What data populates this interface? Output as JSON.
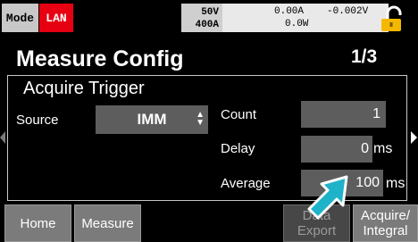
{
  "status": {
    "mode_label": "Mode",
    "interface_label": "LAN",
    "voltage_range": "50V",
    "current_range": "400A",
    "current_reading": "0.00A",
    "power_reading": "0.0W",
    "voltage_reading": "-0.002V",
    "lock_icon": "padlock-unlocked-icon"
  },
  "header": {
    "title": "Measure Config",
    "page": "1/3"
  },
  "section": {
    "title": "Acquire Trigger",
    "source_label": "Source",
    "source_value": "IMM",
    "count_label": "Count",
    "count_value": "1",
    "delay_label": "Delay",
    "delay_value": "0",
    "delay_unit": "ms",
    "average_label": "Average",
    "average_value": "100",
    "average_unit": "ms"
  },
  "softkeys": {
    "home": "Home",
    "measure": "Measure",
    "data_export_1": "Data",
    "data_export_2": "Export",
    "acquire_integral_1": "Acquire/",
    "acquire_integral_2": "Integral"
  },
  "colors": {
    "lan_badge": "#e60012",
    "lock_icon": "#f5b800",
    "cursor_arrow": "#1fb3c9"
  }
}
